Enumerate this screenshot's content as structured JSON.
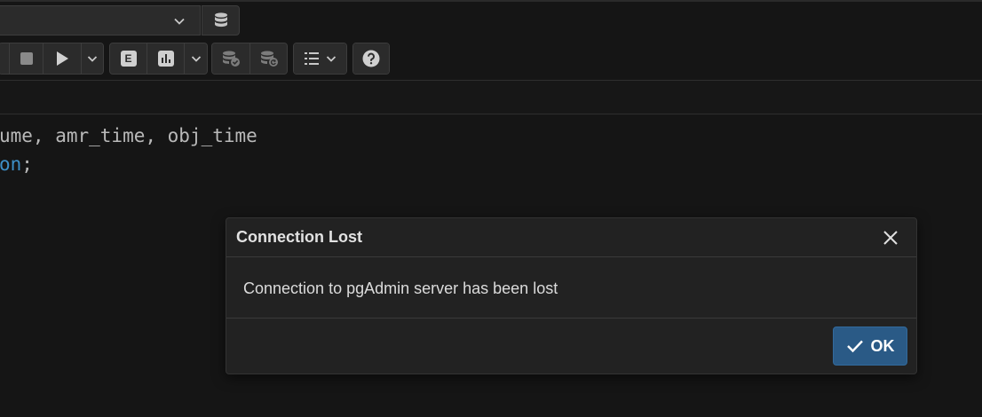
{
  "toolbar": {
    "connection_select": {
      "value": "",
      "icon": "chevron-down-icon"
    },
    "database_icon": "database-icon",
    "buttons": [
      {
        "name": "stop-button",
        "icon": "stop-icon"
      },
      {
        "name": "execute-button",
        "icon": "play-icon"
      },
      {
        "name": "execute-options-button",
        "icon": "chevron-down-icon"
      },
      {
        "name": "explain-button",
        "label": "E"
      },
      {
        "name": "explain-analyze-button",
        "icon": "bar-chart-icon"
      },
      {
        "name": "explain-options-button",
        "icon": "chevron-down-icon"
      },
      {
        "name": "commit-button",
        "icon": "database-check-icon"
      },
      {
        "name": "rollback-button",
        "icon": "database-undo-icon"
      },
      {
        "name": "macros-button",
        "icon": "list-icon"
      },
      {
        "name": "help-button",
        "icon": "question-icon"
      }
    ]
  },
  "editor": {
    "line1": "ume, amr_time, obj_time",
    "line2_keyword": "on",
    "line2_rest": ";"
  },
  "dialog": {
    "title": "Connection Lost",
    "message": "Connection to pgAdmin server has been lost",
    "ok_label": "OK",
    "colors": {
      "ok_background": "#2a5a86",
      "background": "#222222"
    }
  },
  "theme": {
    "background": "#151515",
    "keyword_color": "#3d8fc7",
    "code_color": "#b9b9b9"
  }
}
